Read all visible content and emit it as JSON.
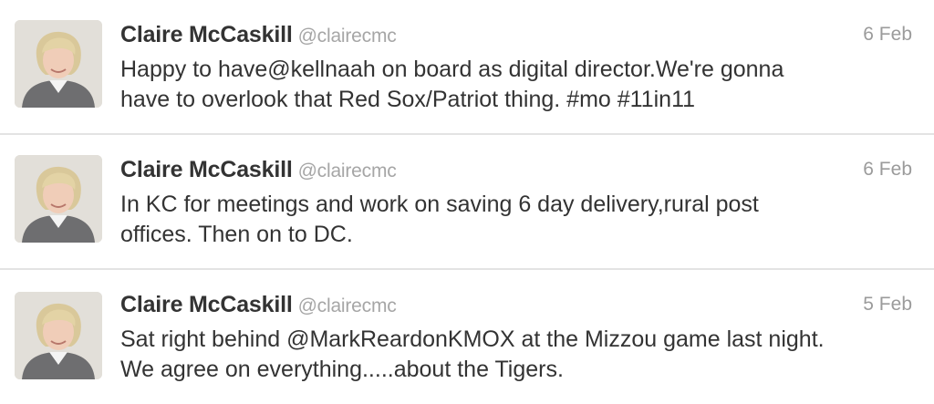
{
  "tweets": [
    {
      "name": "Claire McCaskill",
      "handle": "@clairecmc",
      "date": "6 Feb",
      "lines": [
        "Happy to have@kellnaah on board as digital director.We're gonna",
        "have to overlook that Red Sox/Patriot thing. #mo #11in11"
      ]
    },
    {
      "name": "Claire McCaskill",
      "handle": "@clairecmc",
      "date": "6 Feb",
      "lines": [
        "In KC for meetings and work on saving 6 day delivery,rural post",
        "offices. Then on to DC."
      ]
    },
    {
      "name": "Claire McCaskill",
      "handle": "@clairecmc",
      "date": "5 Feb",
      "lines": [
        "Sat right behind @MarkReardonKMOX at the Mizzou game last night.",
        "We agree on everything.....about the Tigers."
      ]
    }
  ]
}
